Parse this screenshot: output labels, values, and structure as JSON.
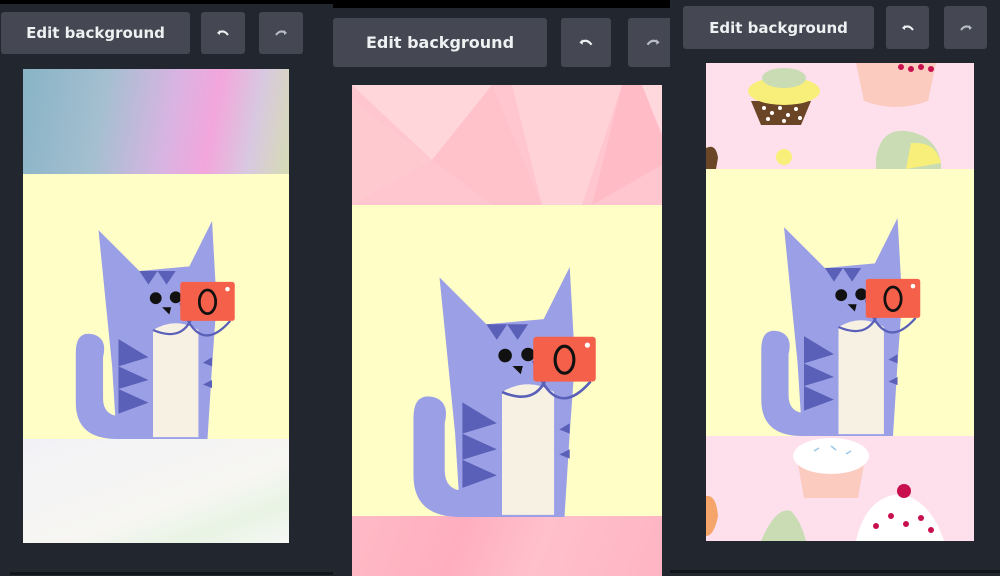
{
  "panels": [
    {
      "edit_label": "Edit background",
      "undo_icon": "undo-icon",
      "redo_icon": "redo-icon",
      "background_theme": "watercolor",
      "colors": {
        "mid": "#fffec6",
        "top_a": "#8fb8c8",
        "top_b": "#f4a6d8",
        "bottom": "#f6f6f3"
      }
    },
    {
      "edit_label": "Edit background",
      "undo_icon": "undo-icon",
      "redo_icon": "redo-icon",
      "background_theme": "pink-polygons",
      "colors": {
        "mid": "#fffec6",
        "top_a": "#ffd3d8",
        "top_b": "#ffbfc8",
        "bottom": "#ffb3c2"
      }
    },
    {
      "edit_label": "Edit background",
      "undo_icon": "undo-icon",
      "redo_icon": "redo-icon",
      "background_theme": "cupcakes",
      "colors": {
        "mid": "#fffec6",
        "top_a": "#fde0ec",
        "top_b": "#fde0ec",
        "bottom": "#fde0ec"
      }
    }
  ],
  "illustration": {
    "subject": "cat-with-camera",
    "colors": {
      "body": "#9ba0e6",
      "stripes": "#5a5fb8",
      "belly": "#f7f1e4",
      "camera": "#f5604a",
      "lens": "#111111"
    }
  }
}
